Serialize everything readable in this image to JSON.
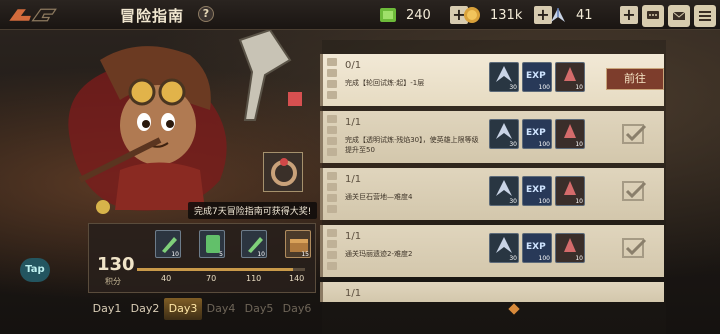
{
  "header": {
    "title": "冒险指南",
    "help": "?",
    "resources": [
      {
        "name": "green-crystal-icon",
        "value": "240"
      },
      {
        "name": "coin-icon",
        "value": "131k"
      },
      {
        "name": "feather-token-icon",
        "value": "41"
      }
    ],
    "plus": "+"
  },
  "character": {
    "banner": "完成7天冒险指南可获得大奖!"
  },
  "progress": {
    "points": "130",
    "points_label": "积分",
    "fill": 0.93,
    "rewards": [
      {
        "icon": "weapon-shard-icon",
        "qty": "10",
        "milestone": "40"
      },
      {
        "icon": "ticket-icon",
        "qty": "5",
        "milestone": "70"
      },
      {
        "icon": "weapon-shard-icon",
        "qty": "10",
        "milestone": "110"
      },
      {
        "icon": "chest-icon",
        "qty": "15",
        "milestone": "140"
      }
    ]
  },
  "days": [
    "Day1",
    "Day2",
    "Day3",
    "Day4",
    "Day5",
    "Day6"
  ],
  "tap": "Tap",
  "quests": [
    {
      "progress": "0/1",
      "desc": "完成【轮回试炼·起】-1层",
      "action": "前往",
      "done": false,
      "rewards": [
        {
          "qty": "30"
        },
        {
          "qty": "100",
          "exp": "EXP"
        },
        {
          "qty": "10"
        }
      ]
    },
    {
      "progress": "1/1",
      "desc": "完成【透明试炼·残焰30】，使英雄上限等级提升至50",
      "action": "",
      "done": true,
      "rewards": [
        {
          "qty": "30"
        },
        {
          "qty": "100",
          "exp": "EXP"
        },
        {
          "qty": "10"
        }
      ]
    },
    {
      "progress": "1/1",
      "desc": "通关巨石营地—难度4",
      "action": "",
      "done": true,
      "rewards": [
        {
          "qty": "30"
        },
        {
          "qty": "100",
          "exp": "EXP"
        },
        {
          "qty": "10"
        }
      ]
    },
    {
      "progress": "1/1",
      "desc": "通关玛丽遗迹2-难度2",
      "action": "",
      "done": true,
      "rewards": [
        {
          "qty": "30"
        },
        {
          "qty": "100",
          "exp": "EXP"
        },
        {
          "qty": "10"
        }
      ]
    },
    {
      "progress": "1/1",
      "desc": "",
      "action": "",
      "done": true,
      "rewards": []
    }
  ]
}
